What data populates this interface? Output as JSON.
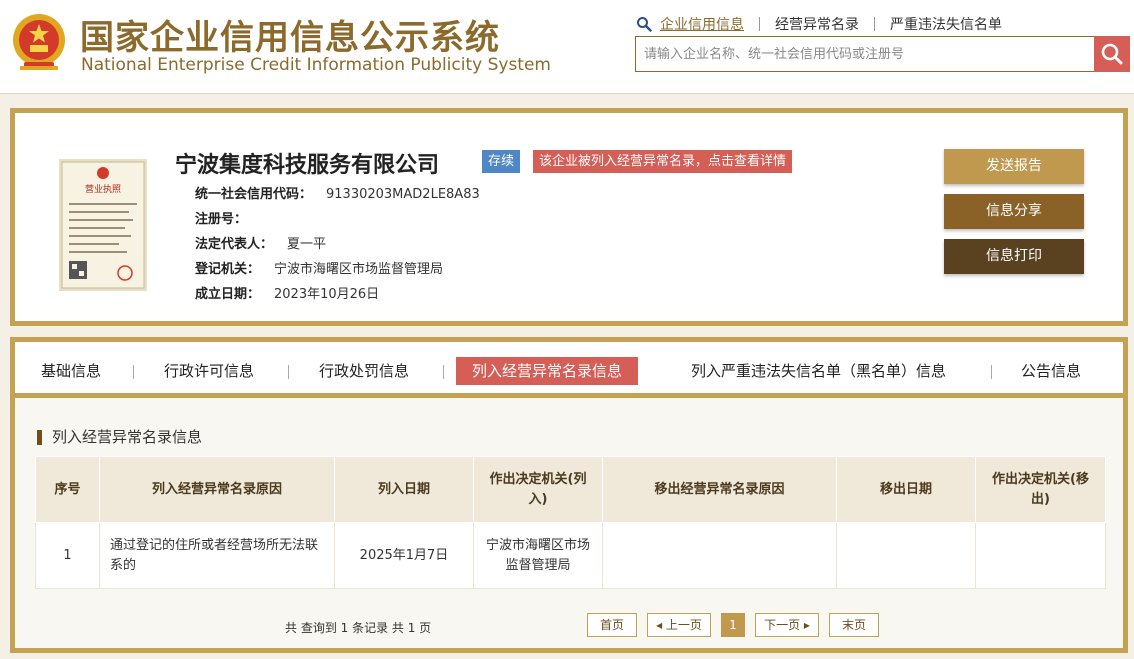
{
  "header": {
    "title_cn": "国家企业信用信息公示系统",
    "title_en": "National Enterprise Credit Information Publicity System",
    "nav": [
      "企业信用信息",
      "经营异常名录",
      "严重违法失信名单"
    ],
    "search_placeholder": "请输入企业名称、统一社会信用代码或注册号",
    "icons": {
      "emblem": "national-emblem-icon",
      "nav": "search-icon",
      "search": "search-icon"
    }
  },
  "company": {
    "name": "宁波集度科技服务有限公司",
    "status": "存续",
    "abnormal_notice": "该企业被列入经营异常名录，点击查看详情",
    "license_image_label": "营业执照",
    "fields": [
      {
        "label": "统一社会信用代码：",
        "value": "91330203MAD2LE8A83"
      },
      {
        "label": "注册号：",
        "value": ""
      },
      {
        "label": "法定代表人：",
        "value": "夏一平"
      },
      {
        "label": "登记机关：",
        "value": "宁波市海曙区市场监督管理局"
      },
      {
        "label": "成立日期：",
        "value": "2023年10月26日"
      }
    ],
    "buttons": {
      "report": "发送报告",
      "share": "信息分享",
      "print": "信息打印"
    }
  },
  "tabs": [
    "基础信息",
    "行政许可信息",
    "行政处罚信息",
    "列入经营异常名录信息",
    "列入严重违法失信名单（黑名单）信息",
    "公告信息"
  ],
  "active_tab_index": 3,
  "section": {
    "title": "列入经营异常名录信息",
    "columns": [
      "序号",
      "列入经营异常名录原因",
      "列入日期",
      "作出决定机关(列入)",
      "移出经营异常名录原因",
      "移出日期",
      "作出决定机关(移出)"
    ],
    "rows": [
      [
        "1",
        "通过登记的住所或者经营场所无法联系的",
        "2025年1月7日",
        "宁波市海曙区市场监督管理局",
        "",
        "",
        ""
      ]
    ]
  },
  "pagination": {
    "summary": "共 查询到 1 条记录 共 1 页",
    "first": "首页",
    "prev": "上一页",
    "current": "1",
    "next": "下一页",
    "last": "末页"
  },
  "colors": {
    "brand": "#8b6a2c",
    "border": "#c4a253",
    "accent_red": "#d55e57",
    "status_blue": "#4f86c6"
  }
}
